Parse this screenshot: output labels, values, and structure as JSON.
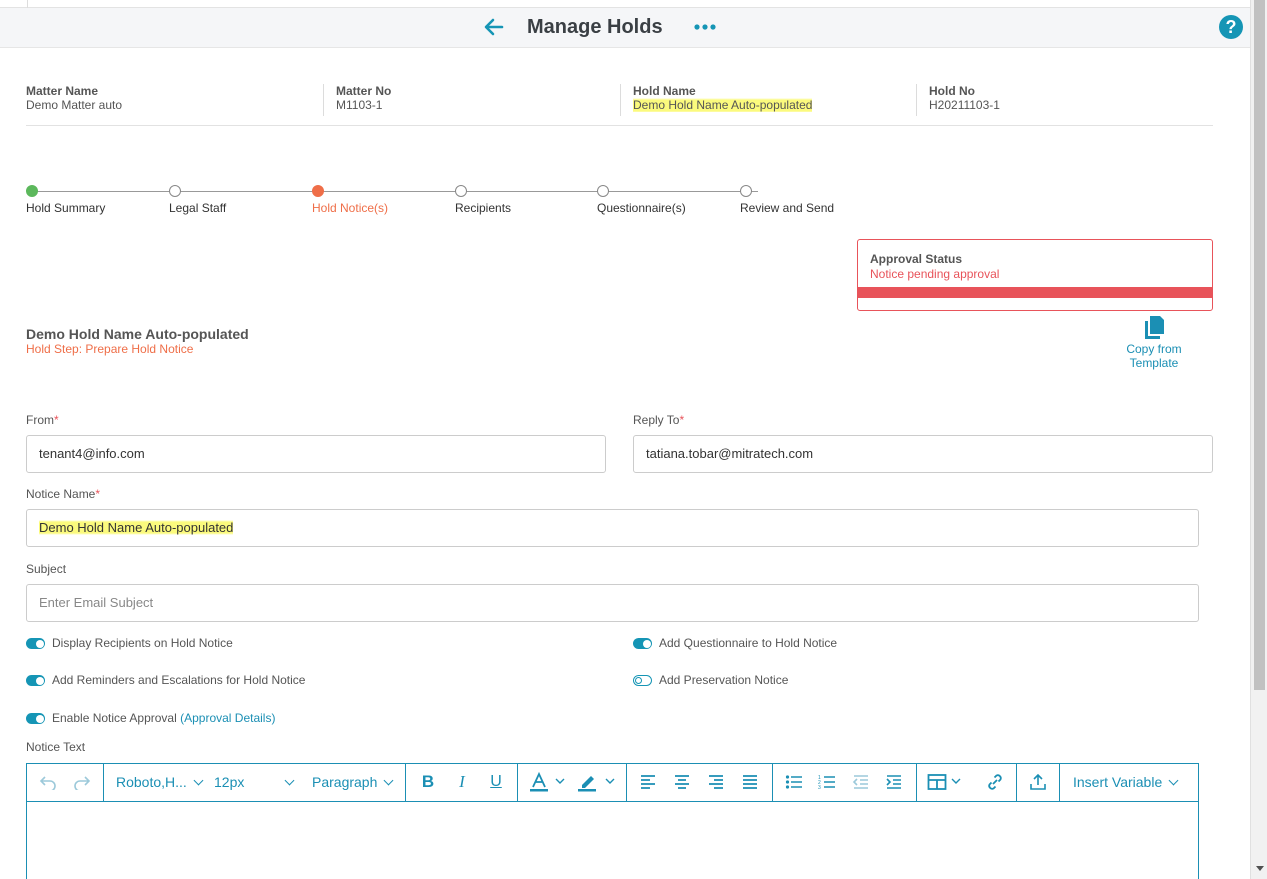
{
  "header": {
    "title": "Manage Holds"
  },
  "info": {
    "matter_name_label": "Matter Name",
    "matter_name": "Demo Matter auto",
    "matter_no_label": "Matter No",
    "matter_no": "M1103-1",
    "hold_name_label": "Hold Name",
    "hold_name": "Demo Hold Name Auto-populated",
    "hold_no_label": "Hold No",
    "hold_no": "H20211103-1"
  },
  "steps": [
    {
      "label": "Hold Summary",
      "state": "done"
    },
    {
      "label": "Legal Staff",
      "state": "pending"
    },
    {
      "label": "Hold Notice(s)",
      "state": "active"
    },
    {
      "label": "Recipients",
      "state": "pending"
    },
    {
      "label": "Questionnaire(s)",
      "state": "pending"
    },
    {
      "label": "Review and Send",
      "state": "pending"
    }
  ],
  "approval": {
    "title": "Approval Status",
    "status": "Notice pending approval"
  },
  "copy_template": {
    "line1": "Copy from",
    "line2": "Template"
  },
  "hold": {
    "title": "Demo Hold Name Auto-populated",
    "step": "Hold Step: Prepare Hold Notice"
  },
  "form": {
    "from_label": "From",
    "from_value": "tenant4@info.com",
    "reply_label": "Reply To",
    "reply_value": "tatiana.tobar@mitratech.com",
    "notice_name_label": "Notice Name",
    "notice_name_value": "Demo Hold Name Auto-populated",
    "subject_label": "Subject",
    "subject_placeholder": "Enter Email Subject",
    "required_mark": "*"
  },
  "toggles": {
    "display_recipients": {
      "label": "Display Recipients on Hold Notice",
      "on": true
    },
    "add_questionnaire": {
      "label": "Add Questionnaire to Hold Notice",
      "on": true
    },
    "add_reminders": {
      "label": "Add Reminders and Escalations for Hold Notice",
      "on": true
    },
    "add_preservation": {
      "label": "Add Preservation Notice",
      "on": false
    },
    "enable_approval": {
      "label": "Enable Notice Approval",
      "link": "(Approval Details)",
      "on": true
    }
  },
  "editor": {
    "label": "Notice Text",
    "font_family": "Roboto,H...",
    "font_size": "12px",
    "block_format": "Paragraph",
    "insert_variable": "Insert Variable"
  },
  "colors": {
    "accent": "#1595b5",
    "active_step": "#ef6e48",
    "done_step": "#5cb85c",
    "alert": "#e8535a",
    "highlight": "#fbfa7d"
  }
}
